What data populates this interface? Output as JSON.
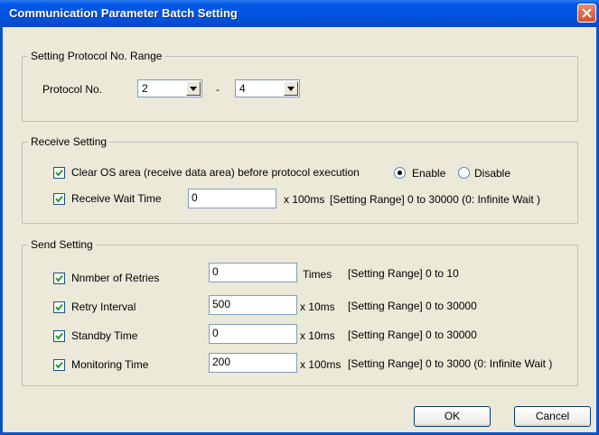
{
  "window": {
    "title": "Communication Parameter Batch Setting"
  },
  "protocol_range": {
    "legend": "Setting Protocol No. Range",
    "label": "Protocol No.",
    "from_value": "2",
    "separator": "-",
    "to_value": "4"
  },
  "receive": {
    "legend": "Receive Setting",
    "clear_os_label": "Clear OS area (receive data area) before protocol execution",
    "clear_os_checked": true,
    "enable_label": "Enable",
    "disable_label": "Disable",
    "enable_selected": true,
    "wait_label": "Receive Wait Time",
    "wait_checked": true,
    "wait_value": "0",
    "wait_unit": "x 100ms",
    "wait_range": "[Setting Range] 0 to 30000 (0: Infinite Wait )"
  },
  "send": {
    "legend": "Send Setting",
    "rows": [
      {
        "label": "Nnmber of Retries",
        "checked": true,
        "value": "0",
        "unit": "Times",
        "range": "[Setting Range] 0 to 10"
      },
      {
        "label": "Retry Interval",
        "checked": true,
        "value": "500",
        "unit": "x 10ms",
        "range": "[Setting Range] 0 to 30000"
      },
      {
        "label": "Standby Time",
        "checked": true,
        "value": "0",
        "unit": "x 10ms",
        "range": "[Setting Range] 0 to 30000"
      },
      {
        "label": "Monitoring Time",
        "checked": true,
        "value": "200",
        "unit": "x 100ms",
        "range": "[Setting Range] 0 to 3000 (0: Infinite Wait )"
      }
    ]
  },
  "buttons": {
    "ok": "OK",
    "cancel": "Cancel"
  },
  "colors": {
    "titlebar": "#0058e6",
    "close": "#d4502b",
    "face": "#ece9d8"
  },
  "icons": {
    "close": "close-icon",
    "dropdown": "chevron-down-icon",
    "check": "checkmark-icon"
  }
}
